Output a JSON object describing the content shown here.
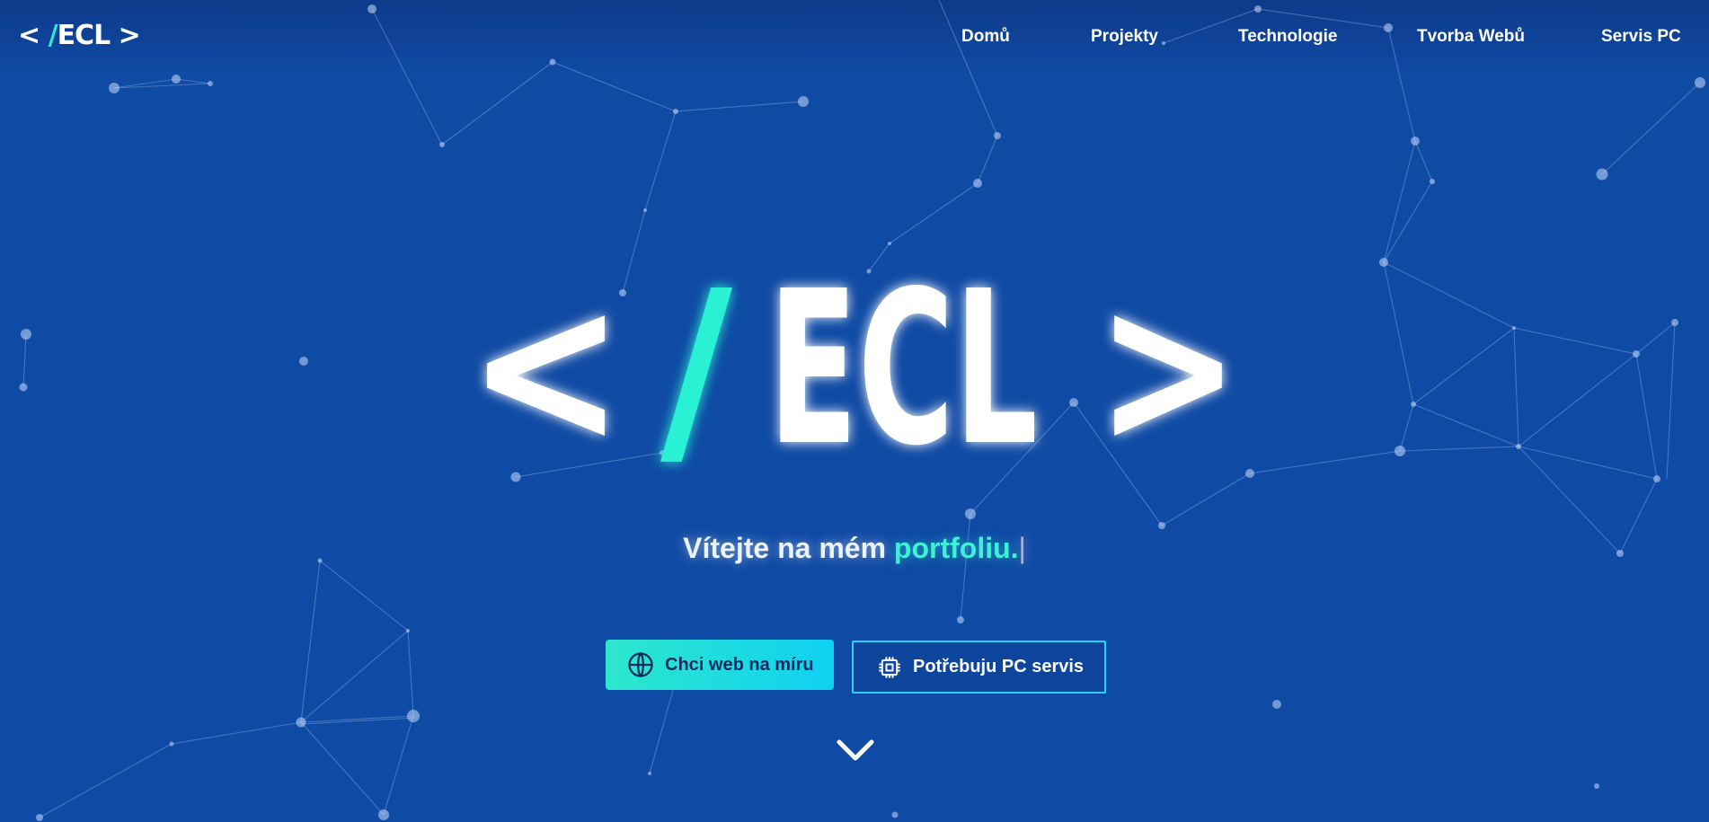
{
  "nav": {
    "logo": {
      "open": "< ",
      "slash": "/",
      "name": "ECL",
      "close": " >"
    },
    "items": [
      {
        "label": "Domů"
      },
      {
        "label": "Projekty"
      },
      {
        "label": "Technologie"
      },
      {
        "label": "Tvorba Webů"
      },
      {
        "label": "Servis PC"
      }
    ]
  },
  "hero": {
    "logo": {
      "open": "<",
      "slash": "/",
      "name": "ECL",
      "close": ">"
    },
    "tagline": {
      "main": "Vítejte na mém ",
      "accent": "portfoliu.",
      "cursor": "|"
    },
    "buttons": {
      "primary": {
        "label": "Chci web na míru",
        "icon": "globe-icon"
      },
      "secondary": {
        "label": "Potřebuju PC servis",
        "icon": "cpu-chip-icon"
      }
    },
    "scroll_icon": "chevron-down-icon"
  },
  "colors": {
    "background": "#0f4aa5",
    "accent": "#2ce8d8",
    "button_gradient_start": "#2de8cc",
    "button_gradient_end": "#10d0f2",
    "outline_button_border": "#2ad3f5"
  }
}
